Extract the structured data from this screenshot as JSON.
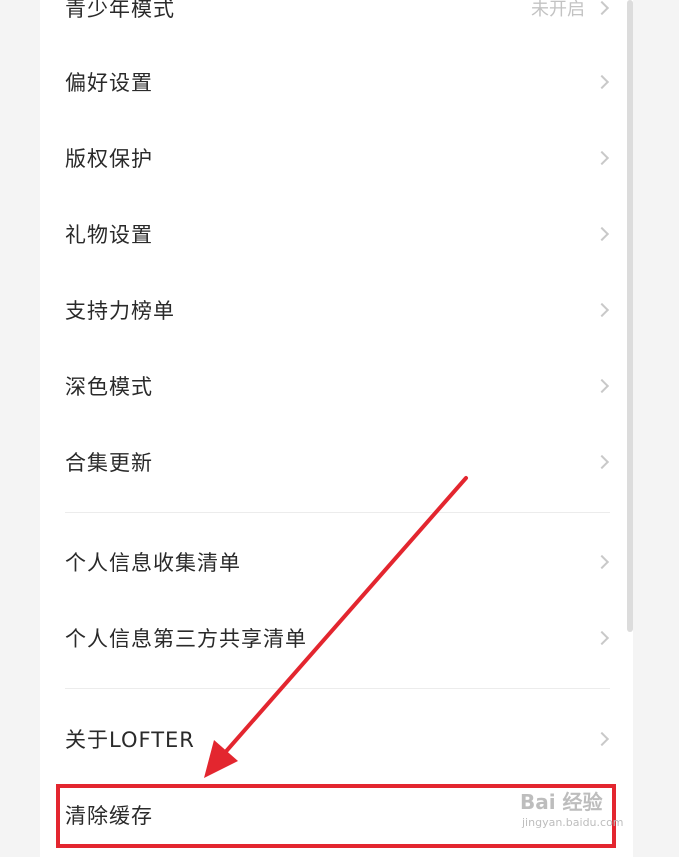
{
  "settings": {
    "items": [
      {
        "label": "青少年模式",
        "value": "未开启"
      },
      {
        "label": "偏好设置"
      },
      {
        "label": "版权保护"
      },
      {
        "label": "礼物设置"
      },
      {
        "label": "支持力榜单"
      },
      {
        "label": "深色模式"
      },
      {
        "label": "合集更新"
      },
      {
        "label": "个人信息收集清单"
      },
      {
        "label": "个人信息第三方共享清单"
      },
      {
        "label": "关于LOFTER"
      },
      {
        "label": "清除缓存"
      }
    ]
  },
  "annotation": {
    "highlight_color": "#e3262f"
  },
  "watermark": {
    "main": "Bai 经验",
    "sub": "jingyan.baidu.com"
  }
}
